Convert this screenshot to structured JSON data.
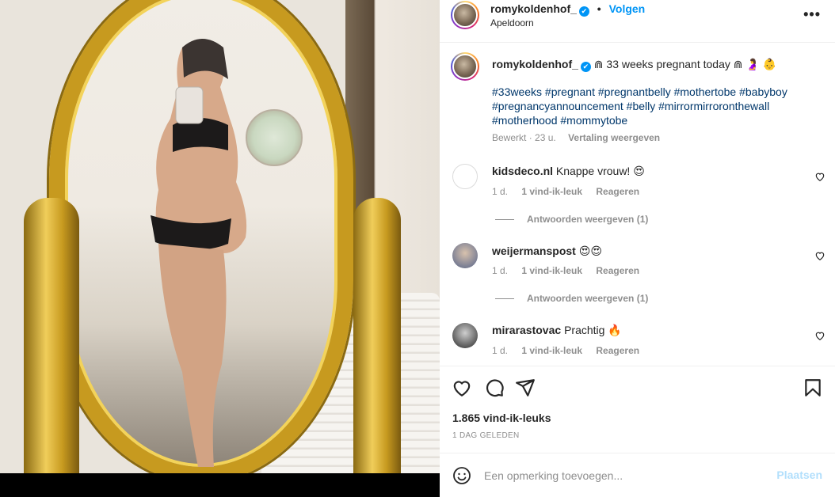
{
  "header": {
    "username": "romykoldenhof_",
    "verified_mark": "✔",
    "separator": "•",
    "follow_label": "Volgen",
    "location": "Apeldoorn",
    "more_label": "•••"
  },
  "caption": {
    "username": "romykoldenhof_",
    "text": "⋒ 33 weeks pregnant today ⋒ 🤰 👶",
    "hashtags": "#33weeks #pregnant #pregnantbelly #mothertobe #babyboy #pregnancyannouncement #belly #mirrormirroronthewall #motherhood #mommytobe",
    "edited": "Bewerkt",
    "age": "23 u.",
    "translate": "Vertaling weergeven"
  },
  "comments": [
    {
      "username": "kidsdeco.nl",
      "text": "Knappe vrouw! 😍",
      "age": "1 d.",
      "likes": "1 vind-ik-leuk",
      "reply": "Reageren",
      "replies": "Antwoorden weergeven (1)"
    },
    {
      "username": "weijermanspost",
      "text": "😍😍",
      "age": "1 d.",
      "likes": "1 vind-ik-leuk",
      "reply": "Reageren",
      "replies": "Antwoorden weergeven (1)"
    },
    {
      "username": "mirarastovac",
      "text": "Prachtig 🔥",
      "age": "1 d.",
      "likes": "1 vind-ik-leuk",
      "reply": "Reageren"
    }
  ],
  "actions": {
    "likes": "1.865 vind-ik-leuks",
    "date": "1 DAG GELEDEN"
  },
  "comment_box": {
    "placeholder": "Een opmerking toevoegen...",
    "post_label": "Plaatsen"
  },
  "icons": {
    "like": "heart-icon",
    "comment": "comment-icon",
    "share": "share-icon",
    "save": "bookmark-icon",
    "emoji": "emoji-icon"
  },
  "colors": {
    "accent": "#0095f6",
    "hashtag": "#00376b",
    "muted": "#8e8e8e",
    "post_disabled": "#b2dffc"
  }
}
